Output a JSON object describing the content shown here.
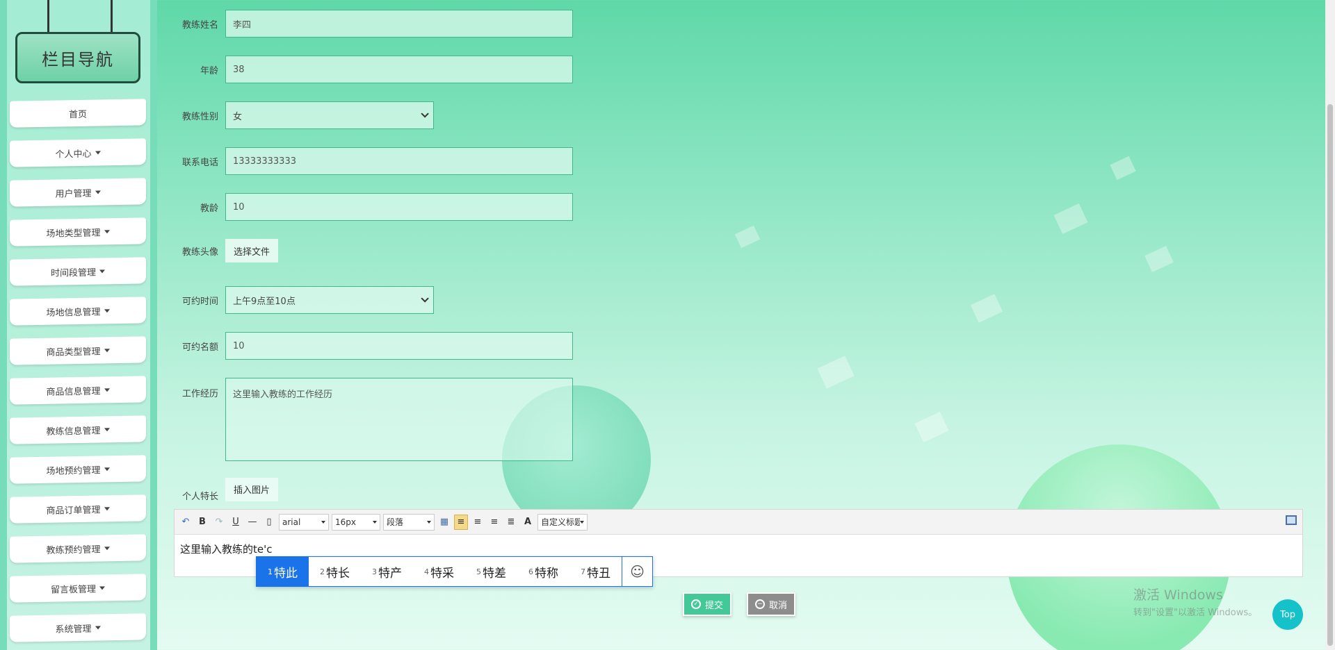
{
  "sidebar": {
    "title": "栏目导航",
    "items": [
      {
        "label": "首页",
        "has_caret": false
      },
      {
        "label": "个人中心",
        "has_caret": true
      },
      {
        "label": "用户管理",
        "has_caret": true
      },
      {
        "label": "场地类型管理",
        "has_caret": true
      },
      {
        "label": "时间段管理",
        "has_caret": true
      },
      {
        "label": "场地信息管理",
        "has_caret": true
      },
      {
        "label": "商品类型管理",
        "has_caret": true
      },
      {
        "label": "商品信息管理",
        "has_caret": true
      },
      {
        "label": "教练信息管理",
        "has_caret": true
      },
      {
        "label": "场地预约管理",
        "has_caret": true
      },
      {
        "label": "商品订单管理",
        "has_caret": true
      },
      {
        "label": "教练预约管理",
        "has_caret": true
      },
      {
        "label": "留言板管理",
        "has_caret": true
      },
      {
        "label": "系统管理",
        "has_caret": true
      }
    ]
  },
  "form": {
    "coach_name": {
      "label": "教练姓名",
      "value": "李四"
    },
    "age": {
      "label": "年龄",
      "value": "38"
    },
    "gender": {
      "label": "教练性别",
      "value": "女"
    },
    "phone": {
      "label": "联系电话",
      "value": "13333333333"
    },
    "coach_years": {
      "label": "教龄",
      "value": "10"
    },
    "avatar": {
      "label": "教练头像",
      "button": "选择文件"
    },
    "available_time": {
      "label": "可约时间",
      "value": "上午9点至10点"
    },
    "quota": {
      "label": "可约名额",
      "value": "10"
    },
    "work_experience": {
      "label": "工作经历",
      "placeholder": "这里输入教练的工作经历"
    },
    "specialty": {
      "label": "个人特长",
      "button": "插入图片"
    }
  },
  "editor": {
    "font_family": "arial",
    "font_size": "16px",
    "paragraph": "段落",
    "custom_title": "自定义标题",
    "content": "这里输入教练的te'c"
  },
  "ime": {
    "candidates": [
      {
        "num": "1",
        "text": "特此"
      },
      {
        "num": "2",
        "text": "特长"
      },
      {
        "num": "3",
        "text": "特产"
      },
      {
        "num": "4",
        "text": "特采"
      },
      {
        "num": "5",
        "text": "特差"
      },
      {
        "num": "6",
        "text": "特称"
      },
      {
        "num": "7",
        "text": "特丑"
      }
    ],
    "emoji": "☺"
  },
  "actions": {
    "submit": "提交",
    "cancel": "取消",
    "top": "Top"
  },
  "watermark": {
    "line1": "激活 Windows",
    "line2": "转到\"设置\"以激活 Windows。"
  }
}
